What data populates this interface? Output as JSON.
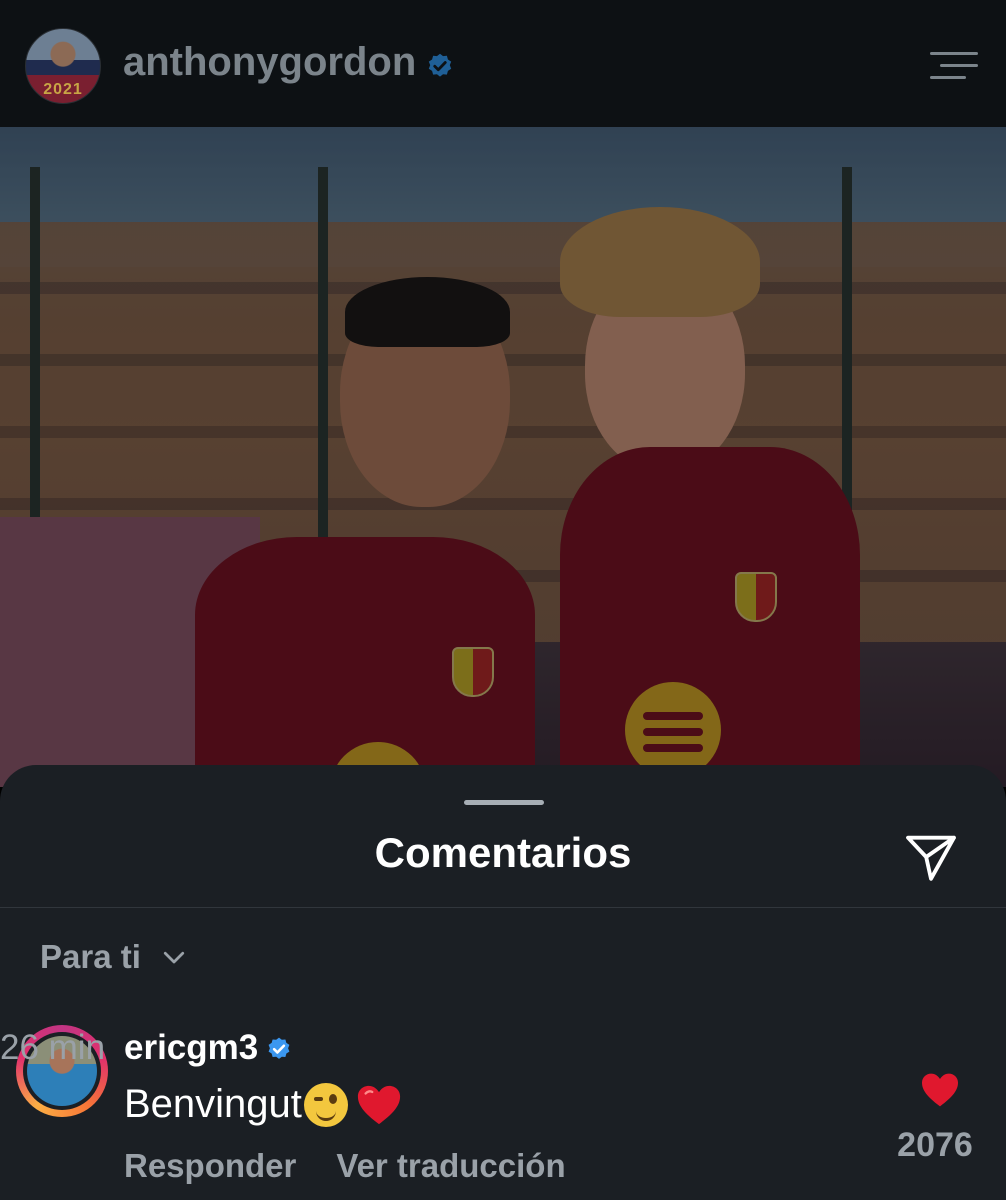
{
  "header": {
    "username": "anthonygordon",
    "avatar_text": "2021",
    "verified_color": "#3b82c4"
  },
  "sheet": {
    "title": "Comentarios",
    "filter_label": "Para ti"
  },
  "comments": [
    {
      "username": "ericgm3",
      "time": "26 min",
      "text": "Benvingut",
      "emojis": [
        "winking-face",
        "red-heart"
      ],
      "likes": "2076",
      "reply_label": "Responder",
      "translate_label": "Ver traducción"
    }
  ],
  "colors": {
    "sheet_bg": "#1b1f24",
    "heart_red": "#e0182e",
    "muted_text": "#9aa1a8"
  }
}
